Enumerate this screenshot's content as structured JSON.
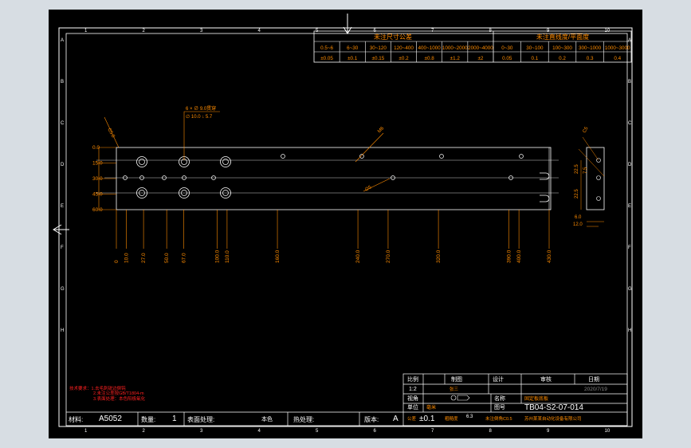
{
  "border": {
    "columns": [
      "1",
      "2",
      "3",
      "4",
      "5",
      "6",
      "7",
      "8",
      "9",
      "10"
    ],
    "rows": [
      "A",
      "B",
      "C",
      "D",
      "E",
      "F",
      "G",
      "H"
    ]
  },
  "tolerance_table": {
    "linear_header": "未注尺寸公差",
    "flatness_header": "未注直线度/平面度",
    "linear_ranges": [
      "0.5~6",
      "6~30",
      "30~120",
      "120~400",
      "400~1000",
      "1000~2000",
      "2000~4000"
    ],
    "linear_values": [
      "±0.05",
      "±0.1",
      "±0.15",
      "±0.2",
      "±0.8",
      "±1.2",
      "±2"
    ],
    "flat_ranges": [
      "0~30",
      "30~100",
      "100~300",
      "300~1000",
      "1000~3000"
    ],
    "flat_values": [
      "0.05",
      "0.1",
      "0.2",
      "0.3",
      "0.4"
    ]
  },
  "dimensions": {
    "horizontal": [
      "0",
      "10.0",
      "27.0",
      "50.0",
      "67.0",
      "100.0",
      "110.0",
      "160.0",
      "240.0",
      "270.0",
      "320.0",
      "390.0",
      "400.0",
      "430.0"
    ],
    "vertical": [
      "0.0",
      "15.0",
      "30.0",
      "45.0",
      "60.0"
    ],
    "callout_hole": "6 × ∅ 9.0贯穿",
    "callout_hole_sub": "∅ 10.0 ↓ 5.7",
    "callout_chamfer": "C5.0",
    "callout_diag_hole": "M6",
    "callout_small_hole": "∅5",
    "side_view": [
      "22.5",
      "22.5",
      "7.5",
      "6.0",
      "12.0",
      "C5"
    ]
  },
  "notes": {
    "line1": "技术要求：1.去毛刺锐边倒钝",
    "line2": "2.未注公差按GB/T1804-m",
    "line3": "3.表面处理：本色阳极氧化"
  },
  "title_block": {
    "scale_label": "比例",
    "scale_value": "1:2",
    "projection_label": "制图",
    "projection_value": "张三",
    "design_label": "设计",
    "check_label": "审核",
    "date_label": "日期",
    "date_value": "2020/7/19",
    "drawing_label": "视角",
    "part_name_label": "名称",
    "part_name_value": "固定板底板",
    "unit_label": "单位",
    "unit_value": "毫米",
    "drawing_no_label": "图号",
    "drawing_no_value": "TB04-S2-07-014",
    "company": "苏州某某自动化设备有限公司",
    "tolerance_label": "公差",
    "tolerance_value": "±0.1",
    "roughness_label": "粗糙度",
    "roughness_value": "6.3",
    "unmarked_label": "未注倒角C0.5"
  },
  "bottom_bar": {
    "material_label": "材料:",
    "material_value": "A5052",
    "quantity_label": "数量:",
    "quantity_value": "1",
    "surface_label": "表面处理:",
    "surface_value": "本色",
    "heat_label": "热处理:",
    "heat_value": "",
    "version_label": "版本:",
    "version_value": "A"
  }
}
